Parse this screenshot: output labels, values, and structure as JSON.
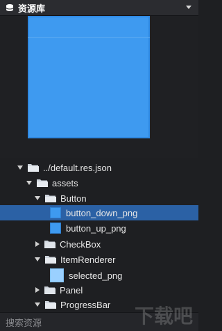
{
  "panel": {
    "title": "资源库"
  },
  "tree": {
    "items": [
      {
        "label": "../default.res.json"
      },
      {
        "label": "assets"
      },
      {
        "label": "Button"
      },
      {
        "label": "button_down_png"
      },
      {
        "label": "button_up_png"
      },
      {
        "label": "CheckBox"
      },
      {
        "label": "ItemRenderer"
      },
      {
        "label": "selected_png"
      },
      {
        "label": "Panel"
      },
      {
        "label": "ProgressBar"
      }
    ]
  },
  "search": {
    "placeholder": "搜索资源"
  },
  "colors": {
    "accent": "#3e9af0",
    "selection": "#2b61a5",
    "background": "#1e1f22"
  },
  "watermark": "下载吧"
}
